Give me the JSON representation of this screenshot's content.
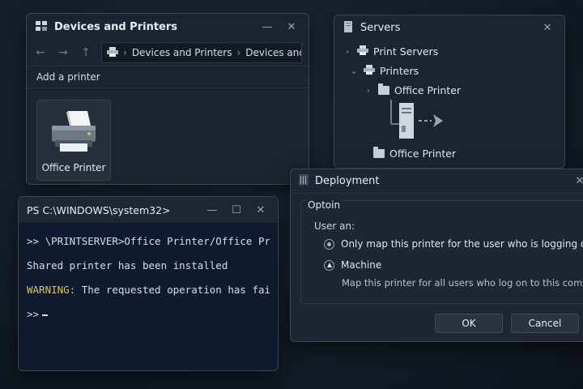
{
  "devices_window": {
    "title": "Devices and Printers",
    "minimize": "—",
    "close": "✕",
    "breadcrumb": [
      "Devices and Printers",
      "Devices and Printer"
    ],
    "command": "Add a printer",
    "tile_label": "Office Printer"
  },
  "servers_window": {
    "title": "Servers",
    "close": "✕",
    "tree": {
      "root": "Print Servers",
      "printers": "Printers",
      "folder1": "Office Printer",
      "folder2": "Office Printer"
    }
  },
  "terminal": {
    "title": "PS C:\\WINDOWS\\system32>",
    "minimize": "—",
    "maximize": "☐",
    "close": "✕",
    "line1": ">> \\PRINTSERVER>Office Printer/Office Prin",
    "line2": "Shared printer has been installed",
    "warn_label": "WARNING:",
    "warn_text": " The requested operation has fail",
    "prompt": ">>"
  },
  "deployment": {
    "title": "Deployment",
    "close": "✕",
    "group_title": "Optoin",
    "user_label": "User an:",
    "option1": "Only map this printer for the user who is logging on",
    "option2": "Machine",
    "option2_desc": "Map this printer for all users who log on to this computer",
    "ok": "OK",
    "cancel": "Cancel"
  }
}
